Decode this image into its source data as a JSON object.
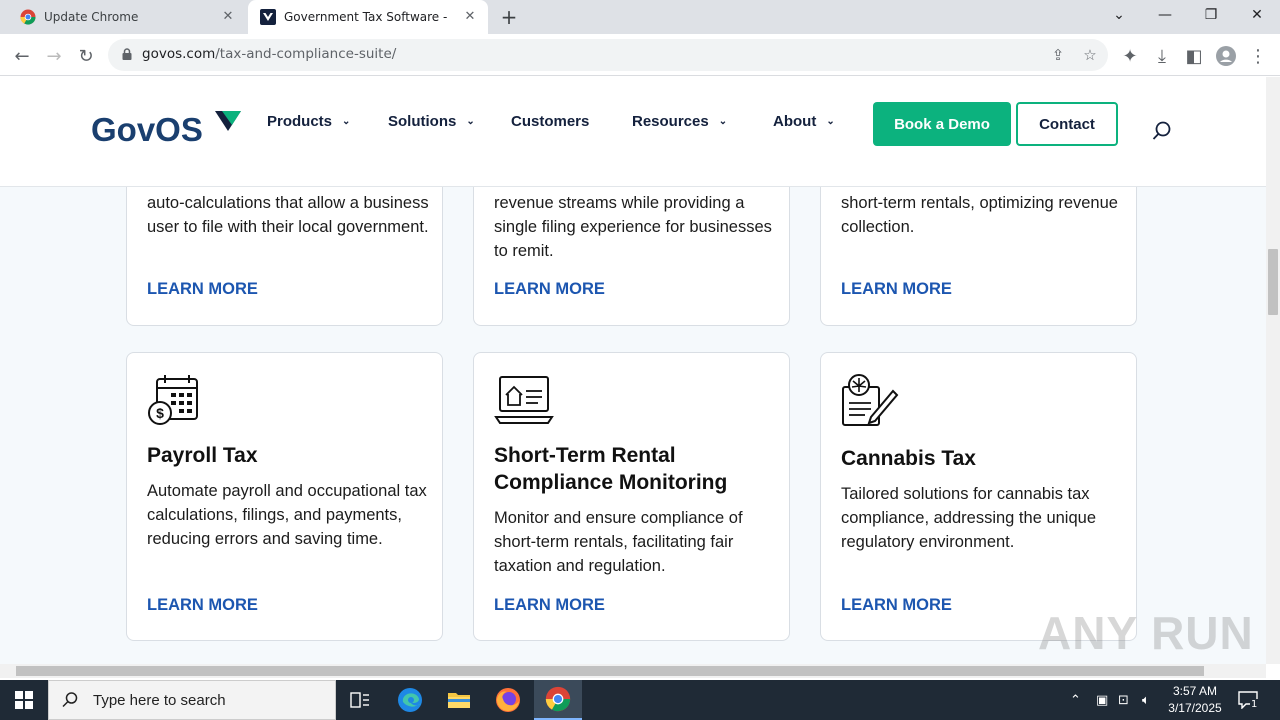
{
  "browser": {
    "tabs": [
      {
        "title": "Update Chrome",
        "active": false
      },
      {
        "title": "Government Tax Software - Tax & Compliance Suite",
        "active": true
      }
    ],
    "url_domain": "govos.com",
    "url_path": "/tax-and-compliance-suite/"
  },
  "site": {
    "logo_text": "GovOS",
    "nav": [
      {
        "label": "Products",
        "dropdown": true
      },
      {
        "label": "Solutions",
        "dropdown": true
      },
      {
        "label": "Customers",
        "dropdown": false
      },
      {
        "label": "Resources",
        "dropdown": true
      },
      {
        "label": "About",
        "dropdown": true
      }
    ],
    "demo_label": "Book a Demo",
    "contact_label": "Contact",
    "colors": {
      "accent": "#0cb27e",
      "navy": "#14213d",
      "link": "#1c56b0",
      "logo_blue": "#1a3f6f"
    }
  },
  "cards_top": [
    {
      "body": "auto-calculations that allow a business user to file with their local government.",
      "link": "LEARN MORE"
    },
    {
      "body": "revenue streams while providing a single filing experience for businesses to remit.",
      "link": "LEARN MORE"
    },
    {
      "body": "short-term rentals, optimizing revenue collection.",
      "link": "LEARN MORE"
    }
  ],
  "cards_bottom": [
    {
      "icon": "payroll-calendar-icon",
      "title": "Payroll Tax",
      "body": "Automate payroll and occupational tax calculations, filings, and payments, reducing errors and saving time.",
      "link": "LEARN MORE"
    },
    {
      "icon": "laptop-house-icon",
      "title": "Short-Term Rental Compliance Monitoring",
      "body": "Monitor and ensure compliance of short-term rentals, facilitating fair taxation and regulation.",
      "link": "LEARN MORE"
    },
    {
      "icon": "cannabis-document-icon",
      "title": "Cannabis Tax",
      "body": "Tailored solutions for cannabis tax compliance, addressing the unique regulatory environment.",
      "link": "LEARN MORE"
    }
  ],
  "watermark": "ANY RUN",
  "taskbar": {
    "search_placeholder": "Type here to search",
    "time": "3:57 AM",
    "date": "3/17/2025",
    "notification_count": "1"
  }
}
